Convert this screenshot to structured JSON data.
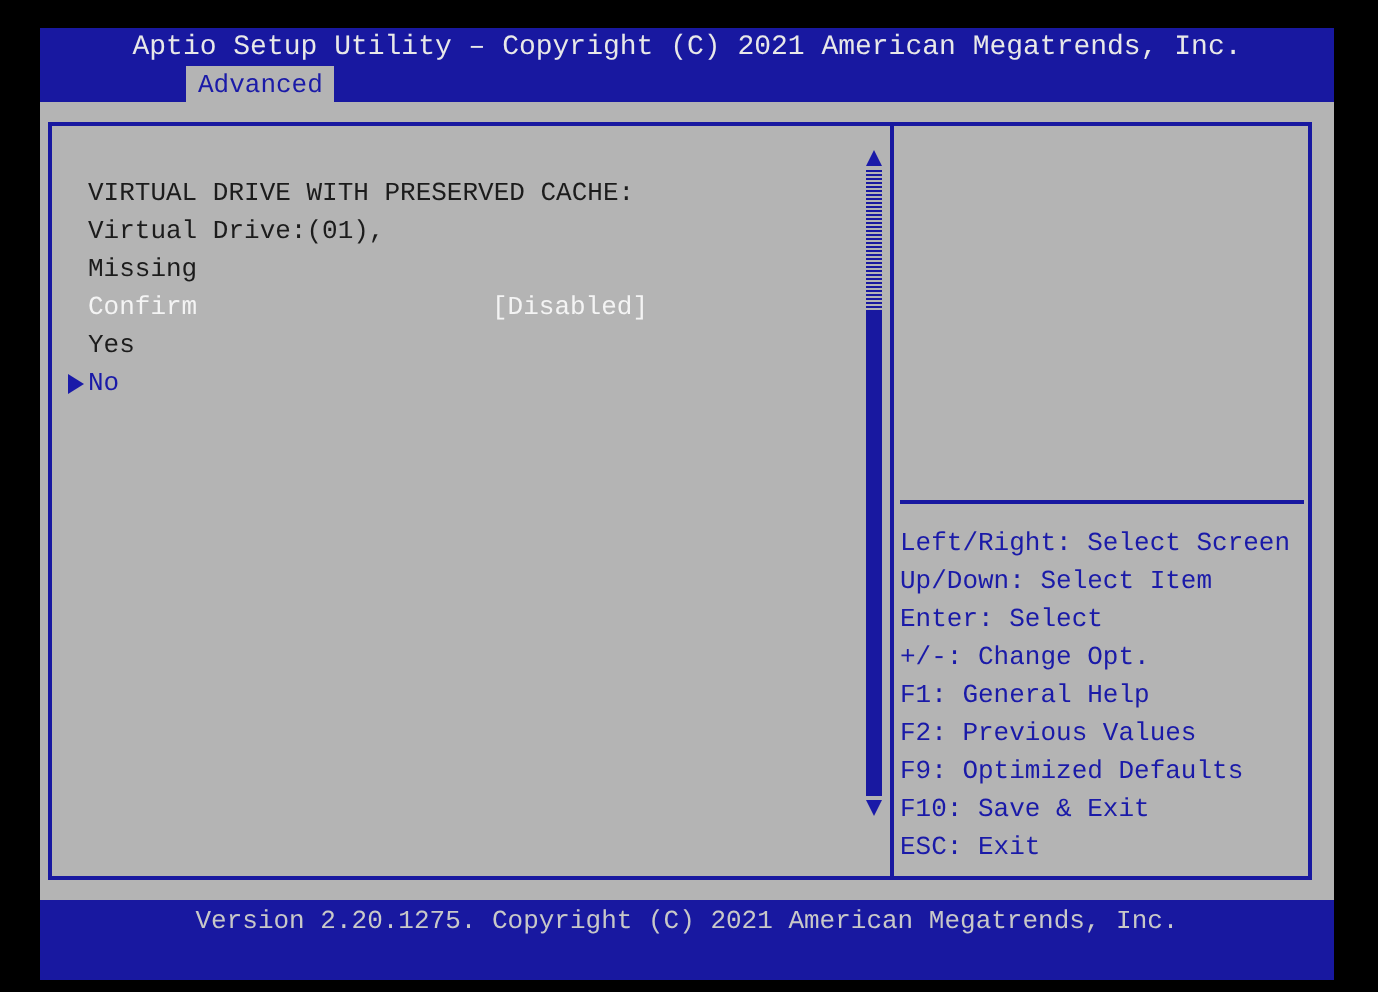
{
  "window": {
    "title": "Aptio Setup Utility – Copyright (C) 2021 American Megatrends, Inc."
  },
  "tabs": [
    {
      "label": "Advanced",
      "selected": true
    }
  ],
  "items": [
    {
      "kind": "text",
      "label": "VIRTUAL DRIVE WITH PRESERVED CACHE:",
      "selected": false
    },
    {
      "kind": "text",
      "label": "Virtual Drive:(01),",
      "selected": false
    },
    {
      "kind": "text",
      "label": "Missing",
      "selected": false
    },
    {
      "kind": "setting",
      "label": "Confirm",
      "value": "[Disabled]",
      "selected": true
    },
    {
      "kind": "text",
      "label": "Yes",
      "selected": false
    },
    {
      "kind": "link",
      "label": "No",
      "selected": false
    }
  ],
  "help": [
    "Left/Right: Select Screen",
    "Up/Down: Select Item",
    "Enter: Select",
    "+/-: Change Opt.",
    "F1: General Help",
    "F2: Previous Values",
    "F9: Optimized Defaults",
    "F10: Save & Exit",
    "ESC: Exit"
  ],
  "status_bar": "Version 2.20.1275. Copyright (C) 2021 American Megatrends, Inc."
}
